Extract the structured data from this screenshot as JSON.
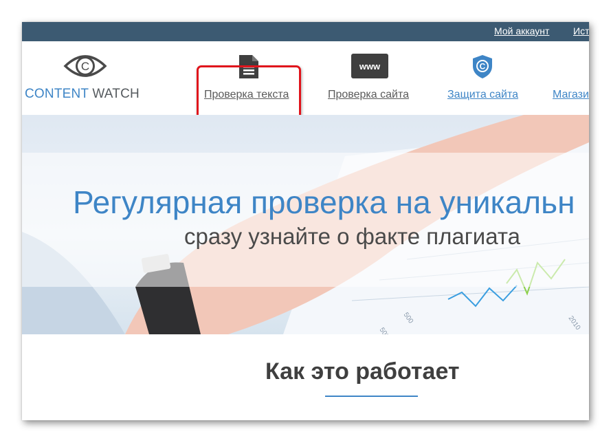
{
  "topbar": {
    "account_link": "Мой аккаунт",
    "history_link": "Ист"
  },
  "logo": {
    "text_content": "CONTENT",
    "text_watch": "WATCH",
    "icon": "eye-copyright-icon"
  },
  "nav": {
    "items": [
      {
        "label": "Проверка текста",
        "icon": "document-icon",
        "highlighted": true
      },
      {
        "label": "Проверка сайта",
        "icon": "www-icon"
      },
      {
        "label": "Защита сайта",
        "icon": "shield-copyright-icon"
      },
      {
        "label": "Магази",
        "icon": "shop-icon"
      }
    ]
  },
  "hero": {
    "title": "Регулярная проверка на уникальн",
    "subtitle": "сразу узнайте о факте плагиата",
    "chart_labels": [
      "500",
      "500",
      "2010"
    ]
  },
  "how": {
    "title": "Как это работает"
  },
  "colors": {
    "topbar": "#3c5a72",
    "accent": "#3e85c6",
    "highlight": "#e0141c"
  }
}
